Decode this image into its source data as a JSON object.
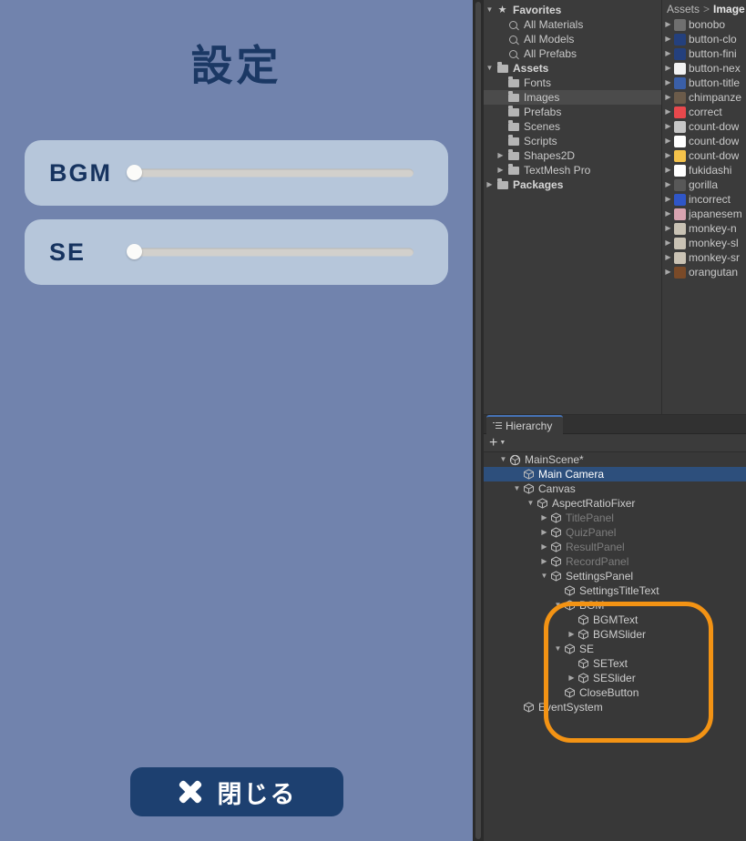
{
  "game": {
    "title": "設定",
    "rows": [
      {
        "label": "BGM",
        "slider_value": 0
      },
      {
        "label": "SE",
        "slider_value": 0
      }
    ],
    "close_button": {
      "label": "閉じる",
      "icon": "close-x-icon"
    },
    "colors": {
      "background": "#7183ad",
      "panel": "#b6c6da",
      "text": "#16335f",
      "button": "#1d4070",
      "button_text": "#ffffff",
      "slider_track": "#d2d0cc",
      "slider_handle": "#fbfbf9"
    }
  },
  "project": {
    "favorites": {
      "label": "Favorites",
      "icon": "star-icon",
      "expanded": true,
      "items": [
        {
          "label": "All Materials",
          "icon": "search-icon"
        },
        {
          "label": "All Models",
          "icon": "search-icon"
        },
        {
          "label": "All Prefabs",
          "icon": "search-icon"
        }
      ]
    },
    "assets": {
      "label": "Assets",
      "icon": "folder-open-icon",
      "expanded": true,
      "items": [
        {
          "label": "Fonts",
          "icon": "folder-icon",
          "expandable": false,
          "selected": false
        },
        {
          "label": "Images",
          "icon": "folder-icon",
          "expandable": false,
          "selected": true
        },
        {
          "label": "Prefabs",
          "icon": "folder-icon",
          "expandable": false,
          "selected": false
        },
        {
          "label": "Scenes",
          "icon": "folder-icon",
          "expandable": false,
          "selected": false
        },
        {
          "label": "Scripts",
          "icon": "folder-icon",
          "expandable": false,
          "selected": false
        },
        {
          "label": "Shapes2D",
          "icon": "folder-icon",
          "expandable": true,
          "selected": false
        },
        {
          "label": "TextMesh Pro",
          "icon": "folder-icon",
          "expandable": true,
          "selected": false
        }
      ]
    },
    "packages": {
      "label": "Packages",
      "icon": "folder-icon",
      "expanded": false
    }
  },
  "assets_pane": {
    "breadcrumb": {
      "root": "Assets",
      "separator": ">",
      "current": "Image"
    },
    "items": [
      {
        "label": "bonobo",
        "thumb": "#6f6f6f"
      },
      {
        "label": "button-clo",
        "thumb": "#24407d"
      },
      {
        "label": "button-fini",
        "thumb": "#24407d"
      },
      {
        "label": "button-nex",
        "thumb": "#f2f2f2"
      },
      {
        "label": "button-title",
        "thumb": "#3a5fa8"
      },
      {
        "label": "chimpanze",
        "thumb": "#6b5b4a"
      },
      {
        "label": "correct",
        "thumb": "#e8484c"
      },
      {
        "label": "count-dow",
        "thumb": "#c6c6c6"
      },
      {
        "label": "count-dow",
        "thumb": "#ffffff"
      },
      {
        "label": "count-dow",
        "thumb": "#f4c24a"
      },
      {
        "label": "fukidashi",
        "thumb": "#ffffff"
      },
      {
        "label": "gorilla",
        "thumb": "#585858"
      },
      {
        "label": "incorrect",
        "thumb": "#2f56c8"
      },
      {
        "label": "japanesem",
        "thumb": "#d8a3b0"
      },
      {
        "label": "monkey-n",
        "thumb": "#c9c2b4"
      },
      {
        "label": "monkey-sl",
        "thumb": "#c9c2b4"
      },
      {
        "label": "monkey-sr",
        "thumb": "#c9c2b4"
      },
      {
        "label": "orangutan",
        "thumb": "#7a4a28"
      }
    ]
  },
  "hierarchy": {
    "tab_label": "Hierarchy",
    "toolbar": {
      "add_label": "+",
      "dropdown_icon": "chevron-down-icon"
    },
    "items": [
      {
        "label": "MainScene*",
        "indent": 1,
        "icon": "unity-scene-icon",
        "twisty": "down",
        "selected": false,
        "inactive": false
      },
      {
        "label": "Main Camera",
        "indent": 2,
        "icon": "gameobject-icon",
        "twisty": "none",
        "selected": true,
        "inactive": false
      },
      {
        "label": "Canvas",
        "indent": 2,
        "icon": "gameobject-icon",
        "twisty": "down",
        "selected": false,
        "inactive": false
      },
      {
        "label": "AspectRatioFixer",
        "indent": 3,
        "icon": "gameobject-icon",
        "twisty": "down",
        "selected": false,
        "inactive": false
      },
      {
        "label": "TitlePanel",
        "indent": 4,
        "icon": "gameobject-icon",
        "twisty": "right",
        "selected": false,
        "inactive": true
      },
      {
        "label": "QuizPanel",
        "indent": 4,
        "icon": "gameobject-icon",
        "twisty": "right",
        "selected": false,
        "inactive": true
      },
      {
        "label": "ResultPanel",
        "indent": 4,
        "icon": "gameobject-icon",
        "twisty": "right",
        "selected": false,
        "inactive": true
      },
      {
        "label": "RecordPanel",
        "indent": 4,
        "icon": "gameobject-icon",
        "twisty": "right",
        "selected": false,
        "inactive": true
      },
      {
        "label": "SettingsPanel",
        "indent": 4,
        "icon": "gameobject-icon",
        "twisty": "down",
        "selected": false,
        "inactive": false
      },
      {
        "label": "SettingsTitleText",
        "indent": 5,
        "icon": "gameobject-icon",
        "twisty": "none",
        "selected": false,
        "inactive": false
      },
      {
        "label": "BGM",
        "indent": 5,
        "icon": "gameobject-icon",
        "twisty": "down",
        "selected": false,
        "inactive": false
      },
      {
        "label": "BGMText",
        "indent": 6,
        "icon": "gameobject-icon",
        "twisty": "none",
        "selected": false,
        "inactive": false
      },
      {
        "label": "BGMSlider",
        "indent": 6,
        "icon": "gameobject-icon",
        "twisty": "right",
        "selected": false,
        "inactive": false
      },
      {
        "label": "SE",
        "indent": 5,
        "icon": "gameobject-icon",
        "twisty": "down",
        "selected": false,
        "inactive": false
      },
      {
        "label": "SEText",
        "indent": 6,
        "icon": "gameobject-icon",
        "twisty": "none",
        "selected": false,
        "inactive": false
      },
      {
        "label": "SESlider",
        "indent": 6,
        "icon": "gameobject-icon",
        "twisty": "right",
        "selected": false,
        "inactive": false
      },
      {
        "label": "CloseButton",
        "indent": 5,
        "icon": "gameobject-icon",
        "twisty": "none",
        "selected": false,
        "inactive": false
      },
      {
        "label": "EventSystem",
        "indent": 2,
        "icon": "gameobject-icon",
        "twisty": "none",
        "selected": false,
        "inactive": false
      }
    ],
    "annotation": {
      "shape": "ellipse",
      "color": "#f39314"
    }
  }
}
